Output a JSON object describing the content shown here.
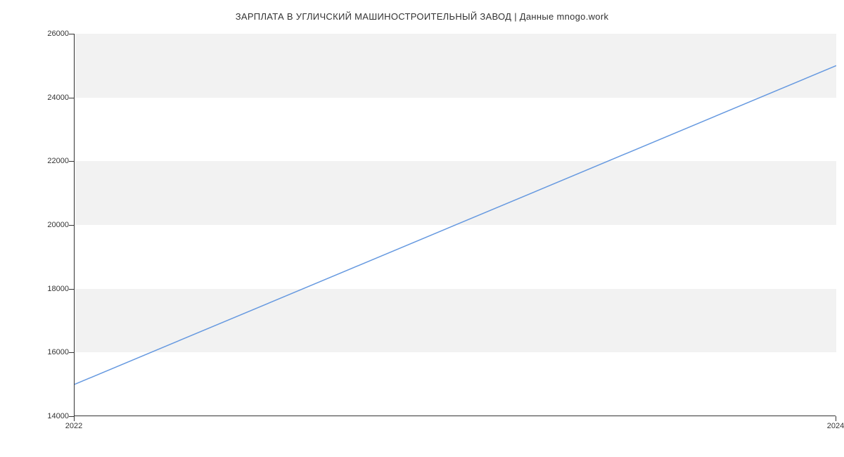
{
  "chart_data": {
    "type": "line",
    "title": "ЗАРПЛАТА В  УГЛИЧСКИЙ МАШИНОСТРОИТЕЛЬНЫЙ ЗАВОД | Данные mnogo.work",
    "x": [
      2022,
      2024
    ],
    "values": [
      15000,
      25000
    ],
    "xlabel": "",
    "ylabel": "",
    "x_ticks": [
      2022,
      2024
    ],
    "y_ticks": [
      14000,
      16000,
      18000,
      20000,
      22000,
      24000,
      26000
    ],
    "xlim": [
      2022,
      2024
    ],
    "ylim": [
      14000,
      26000
    ]
  },
  "colors": {
    "line": "#6699e0",
    "band": "#f2f2f2",
    "axis": "#333333"
  }
}
